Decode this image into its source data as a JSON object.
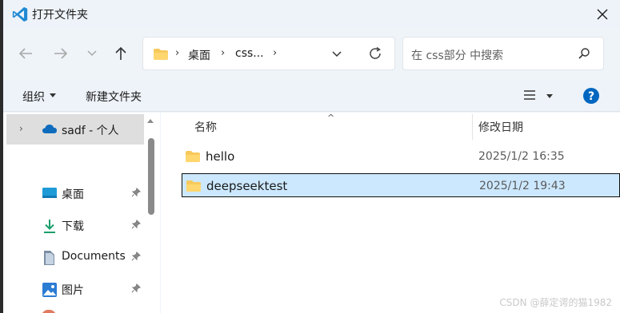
{
  "window": {
    "title": "打开文件夹",
    "accent_color": "#0078d4"
  },
  "navigation": {
    "back_icon": "arrow-left-icon",
    "forward_icon": "arrow-right-icon",
    "recent_icon": "chevron-down-icon",
    "up_icon": "arrow-up-icon"
  },
  "address": {
    "crumbs": [
      "桌面",
      "css..."
    ],
    "separator": "›"
  },
  "search": {
    "placeholder": "在 css部分 中搜索"
  },
  "toolbar": {
    "organize_label": "组织",
    "new_folder_label": "新建文件夹"
  },
  "sidebar": {
    "root": {
      "label": "sadf - 个人",
      "icon": "onedrive-cloud-icon"
    },
    "items": [
      {
        "label": "桌面",
        "icon": "desktop-icon",
        "pinned": true
      },
      {
        "label": "下载",
        "icon": "download-icon",
        "pinned": true
      },
      {
        "label": "Documents",
        "icon": "documents-icon",
        "pinned": true
      },
      {
        "label": "图片",
        "icon": "pictures-icon",
        "pinned": true
      }
    ]
  },
  "files": {
    "columns": [
      "名称",
      "修改日期"
    ],
    "rows": [
      {
        "name": "hello",
        "date": "2025/1/2 16:35",
        "selected": false
      },
      {
        "name": "deepseektest",
        "date": "2025/1/2 19:43",
        "selected": true
      }
    ]
  },
  "watermark": "CSDN @薛定谔的猫1982"
}
